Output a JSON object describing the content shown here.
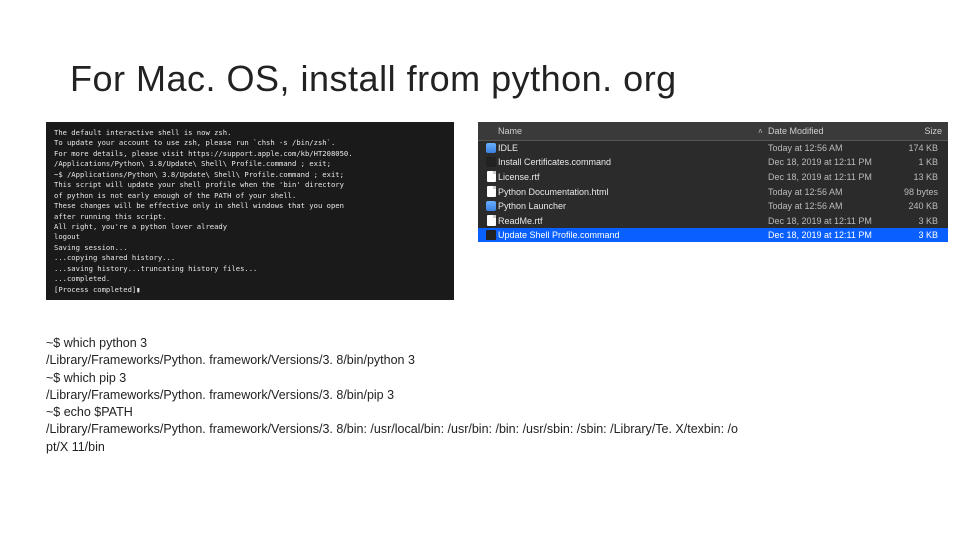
{
  "title": "For Mac. OS, install from python. org",
  "terminal": {
    "lines": [
      "The default interactive shell is now zsh.",
      "To update your account to use zsh, please run `chsh -s /bin/zsh`.",
      "For more details, please visit https://support.apple.com/kb/HT208050.",
      "/Applications/Python\\ 3.8/Update\\ Shell\\ Profile.command ; exit;",
      "~$ /Applications/Python\\ 3.8/Update\\ Shell\\ Profile.command ; exit;",
      "This script will update your shell profile when the 'bin' directory",
      "of python is not early enough of the PATH of your shell.",
      "These changes will be effective only in shell windows that you open",
      "after running this script.",
      "All right, you're a python lover already",
      "logout",
      "Saving session...",
      "...copying shared history...",
      "...saving history...truncating history files...",
      "...completed.",
      "",
      "[Process completed]▮"
    ]
  },
  "finder": {
    "columns": {
      "name": "Name",
      "date": "Date Modified",
      "size": "Size"
    },
    "rows": [
      {
        "icon": "app",
        "name": "IDLE",
        "date": "Today at 12:56 AM",
        "size": "174 KB",
        "selected": false
      },
      {
        "icon": "cmd",
        "name": "Install Certificates.command",
        "date": "Dec 18, 2019 at 12:11 PM",
        "size": "1 KB",
        "selected": false
      },
      {
        "icon": "doc",
        "name": "License.rtf",
        "date": "Dec 18, 2019 at 12:11 PM",
        "size": "13 KB",
        "selected": false
      },
      {
        "icon": "doc",
        "name": "Python Documentation.html",
        "date": "Today at 12:56 AM",
        "size": "98 bytes",
        "selected": false
      },
      {
        "icon": "app",
        "name": "Python Launcher",
        "date": "Today at 12:56 AM",
        "size": "240 KB",
        "selected": false
      },
      {
        "icon": "doc",
        "name": "ReadMe.rtf",
        "date": "Dec 18, 2019 at 12:11 PM",
        "size": "3 KB",
        "selected": false
      },
      {
        "icon": "cmd",
        "name": "Update Shell Profile.command",
        "date": "Dec 18, 2019 at 12:11 PM",
        "size": "3 KB",
        "selected": true
      }
    ]
  },
  "commands": {
    "lines": [
      "~$ which python 3",
      "/Library/Frameworks/Python. framework/Versions/3. 8/bin/python 3",
      "~$ which pip 3",
      "/Library/Frameworks/Python. framework/Versions/3. 8/bin/pip 3",
      "~$ echo $PATH",
      "/Library/Frameworks/Python. framework/Versions/3. 8/bin: /usr/local/bin: /usr/bin: /bin: /usr/sbin: /sbin: /Library/Te. X/texbin: /o",
      "pt/X 11/bin"
    ]
  }
}
